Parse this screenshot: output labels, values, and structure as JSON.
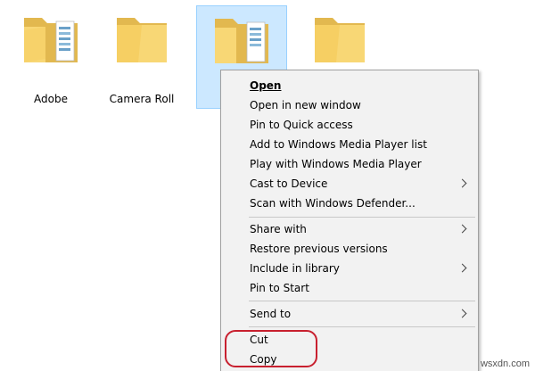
{
  "folders": [
    {
      "name": "Adobe",
      "icon": "folder-with-documents-icon",
      "selected": false
    },
    {
      "name": "Camera Roll",
      "icon": "folder-icon",
      "selected": false
    },
    {
      "name": "",
      "icon": "folder-with-documents-icon",
      "selected": true
    },
    {
      "name": "",
      "icon": "folder-icon",
      "selected": false
    }
  ],
  "context_menu": {
    "items": [
      {
        "label": "Open",
        "access_key": "O",
        "default": true
      },
      {
        "label": "Open in new window",
        "access_key": "e"
      },
      {
        "label": "Pin to Quick access",
        "access_key": ""
      },
      {
        "label": "Add to Windows Media Player list",
        "access_key": "A"
      },
      {
        "label": "Play with Windows Media Player",
        "access_key": "P"
      },
      {
        "label": "Cast to Device",
        "access_key": "",
        "submenu": true
      },
      {
        "label": "Scan with Windows Defender...",
        "access_key": ""
      },
      {
        "label": "Share with",
        "access_key": "h",
        "submenu": true
      },
      {
        "label": "Restore previous versions",
        "access_key": "v"
      },
      {
        "label": "Include in library",
        "access_key": "I",
        "submenu": true
      },
      {
        "label": "Pin to Start",
        "access_key": "P"
      },
      {
        "label": "Send to",
        "access_key": "n",
        "submenu": true
      },
      {
        "label": "Cut",
        "access_key": "t"
      },
      {
        "label": "Copy",
        "access_key": "C"
      }
    ]
  },
  "annotation": {
    "color": "#c8202f",
    "highlights": [
      "Cut",
      "Copy"
    ]
  },
  "colors": {
    "selection_fill": "#cce8ff",
    "selection_border": "#99d1ff",
    "menu_background": "#f2f2f2",
    "folder_yellow": "#f8d775"
  },
  "watermark": "wsxdn.com"
}
